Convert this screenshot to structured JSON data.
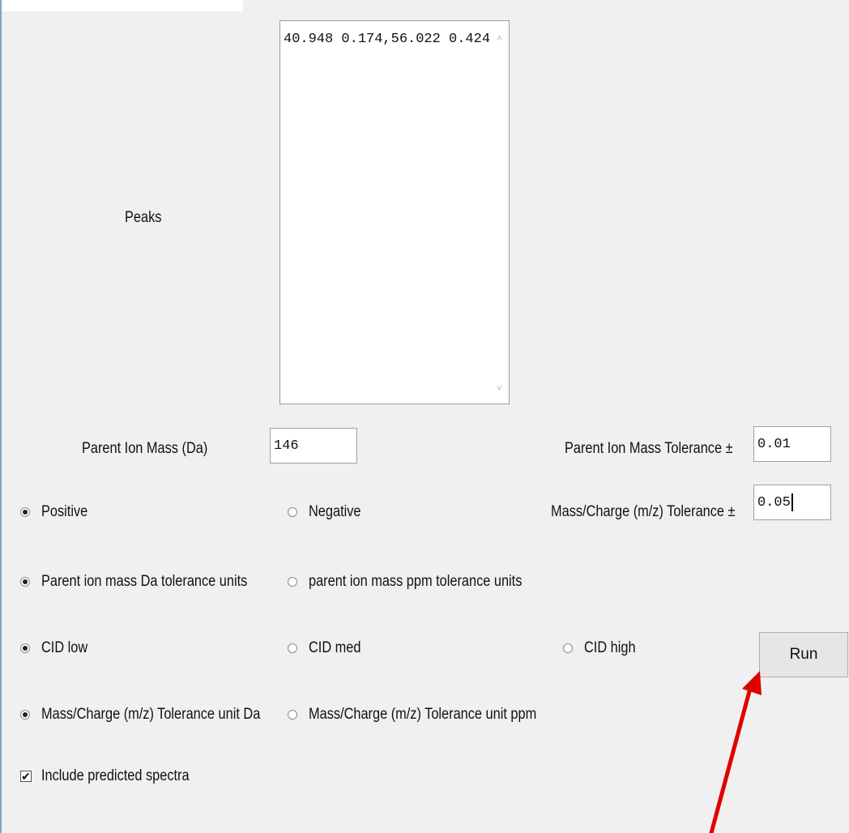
{
  "labels": {
    "peaks": "Peaks",
    "parent_ion_mass": "Parent Ion Mass (Da)",
    "parent_ion_mass_tolerance": "Parent Ion Mass Tolerance ±",
    "mz_tolerance": "Mass/Charge (m/z) Tolerance ±"
  },
  "peaks_textarea": {
    "value": "40.948 0.174,56.022 0.424",
    "scroll_up_glyph": "˄",
    "scroll_down_glyph": "˅"
  },
  "fields": {
    "parent_ion_mass": "146",
    "parent_ion_mass_tolerance": "0.01",
    "mz_tolerance": "0.05"
  },
  "radio_groups": {
    "polarity": {
      "options": [
        "Positive",
        "Negative"
      ],
      "selected": "Positive"
    },
    "parent_tolerance_units": {
      "options": [
        "Parent ion mass Da tolerance units",
        "parent ion mass ppm tolerance units"
      ],
      "selected": "Parent ion mass Da tolerance units"
    },
    "cid_energy": {
      "options": [
        "CID low",
        "CID med",
        "CID high"
      ],
      "selected": "CID low"
    },
    "mz_tolerance_units": {
      "options": [
        "Mass/Charge (m/z) Tolerance unit Da",
        "Mass/Charge (m/z) Tolerance unit ppm"
      ],
      "selected": "Mass/Charge (m/z) Tolerance unit Da"
    }
  },
  "checkbox": {
    "label": "Include predicted spectra",
    "checked": true,
    "check_glyph": "✔"
  },
  "run_button": {
    "label": "Run"
  },
  "colors": {
    "annotation_arrow": "#e00000",
    "window_bg": "#f0f0f0"
  }
}
